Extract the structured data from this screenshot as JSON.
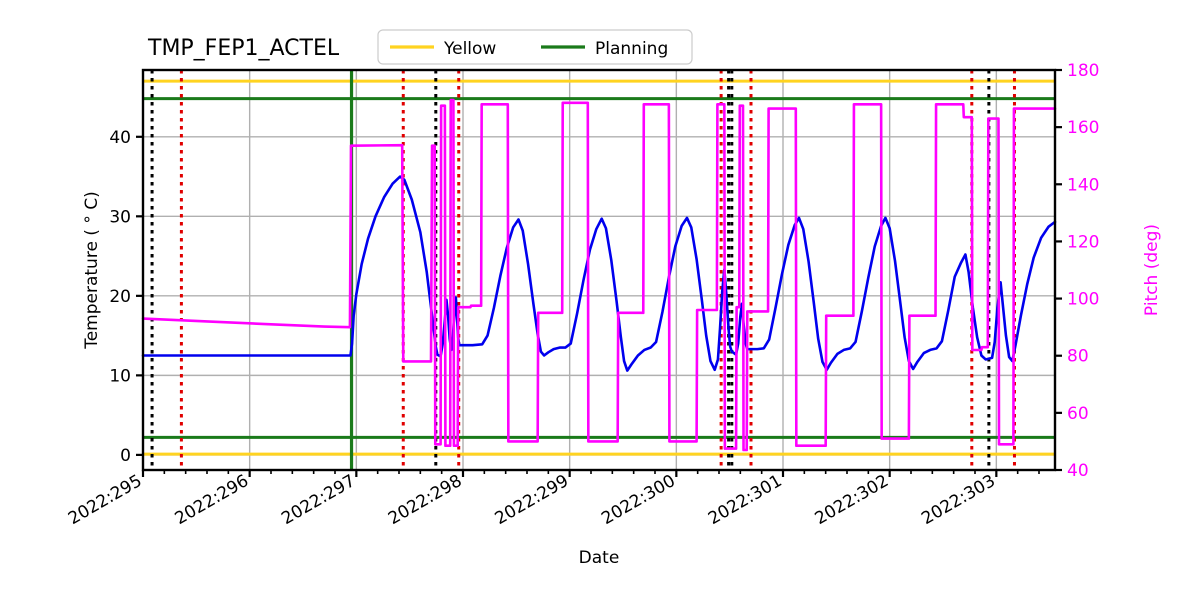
{
  "chart_data": {
    "type": "line",
    "title": "TMP_FEP1_ACTEL",
    "xlabel": "Date",
    "ylabel": "Temperature ( ° C)",
    "y2label": "Pitch (deg)",
    "xlim": [
      295.0,
      303.55
    ],
    "ylim": [
      -1.9,
      48.4
    ],
    "y2lim": [
      40.0,
      180.0
    ],
    "grid": true,
    "legend_position": "upper-center",
    "legend": [
      {
        "label": "Yellow",
        "color": "#FFD320"
      },
      {
        "label": "Planning",
        "color": "#1A7A1A"
      }
    ],
    "xticks": [
      {
        "value": 295,
        "label": "2022:295"
      },
      {
        "value": 296,
        "label": "2022:296"
      },
      {
        "value": 297,
        "label": "2022:297"
      },
      {
        "value": 298,
        "label": "2022:298"
      },
      {
        "value": 299,
        "label": "2022:299"
      },
      {
        "value": 300,
        "label": "2022:300"
      },
      {
        "value": 301,
        "label": "2022:301"
      },
      {
        "value": 302,
        "label": "2022:302"
      },
      {
        "value": 303,
        "label": "2022:303"
      }
    ],
    "yticks": [
      {
        "value": 0,
        "label": "0"
      },
      {
        "value": 10,
        "label": "10"
      },
      {
        "value": 20,
        "label": "20"
      },
      {
        "value": 30,
        "label": "30"
      },
      {
        "value": 40,
        "label": "40"
      }
    ],
    "y2ticks": [
      {
        "value": 40,
        "label": "40"
      },
      {
        "value": 60,
        "label": "60"
      },
      {
        "value": 80,
        "label": "80"
      },
      {
        "value": 100,
        "label": "100"
      },
      {
        "value": 120,
        "label": "120"
      },
      {
        "value": 140,
        "label": "140"
      },
      {
        "value": 160,
        "label": "160"
      },
      {
        "value": 180,
        "label": "180"
      }
    ],
    "hlines": [
      {
        "name": "yellow-high-limit",
        "value": 47.0,
        "color": "#FFD320",
        "axis": "left"
      },
      {
        "name": "planning-high-limit",
        "value": 44.8,
        "color": "#1A7A1A",
        "axis": "left"
      },
      {
        "name": "planning-low-limit",
        "value": 2.2,
        "color": "#1A7A1A",
        "axis": "left"
      },
      {
        "name": "yellow-low-limit",
        "value": 0.1,
        "color": "#FFD320",
        "axis": "left"
      }
    ],
    "vlines_black": [
      295.085,
      297.745,
      300.49,
      300.52,
      302.93
    ],
    "vlines_red": [
      295.36,
      297.44,
      297.96,
      300.42,
      300.7,
      302.77,
      303.17
    ],
    "vline_green": 296.955,
    "series": [
      {
        "name": "temperature",
        "color": "#0000EE",
        "axis": "left",
        "points": [
          [
            295.0,
            12.5
          ],
          [
            295.3,
            12.5
          ],
          [
            295.7,
            12.5
          ],
          [
            296.1,
            12.5
          ],
          [
            296.5,
            12.5
          ],
          [
            296.85,
            12.5
          ],
          [
            296.945,
            12.5
          ],
          [
            296.96,
            14.0
          ],
          [
            296.975,
            17.5
          ],
          [
            297.0,
            20.2
          ],
          [
            297.05,
            24.0
          ],
          [
            297.11,
            27.2
          ],
          [
            297.18,
            30.0
          ],
          [
            297.26,
            32.4
          ],
          [
            297.34,
            34.1
          ],
          [
            297.41,
            35.0
          ],
          [
            297.45,
            34.6
          ],
          [
            297.52,
            32.1
          ],
          [
            297.6,
            28.0
          ],
          [
            297.66,
            23.0
          ],
          [
            297.71,
            17.5
          ],
          [
            297.745,
            13.6
          ],
          [
            297.76,
            12.6
          ],
          [
            297.79,
            12.4
          ],
          [
            297.81,
            14.0
          ],
          [
            297.83,
            17.0
          ],
          [
            297.845,
            19.5
          ],
          [
            297.86,
            17.5
          ],
          [
            297.875,
            14.6
          ],
          [
            297.89,
            13.2
          ],
          [
            297.905,
            14.8
          ],
          [
            297.92,
            18.0
          ],
          [
            297.933,
            19.8
          ],
          [
            297.945,
            17.0
          ],
          [
            297.955,
            14.7
          ],
          [
            297.965,
            13.8
          ],
          [
            298.0,
            13.8
          ],
          [
            298.09,
            13.8
          ],
          [
            298.18,
            13.9
          ],
          [
            298.23,
            15.0
          ],
          [
            298.29,
            18.5
          ],
          [
            298.35,
            22.5
          ],
          [
            298.41,
            26.0
          ],
          [
            298.47,
            28.6
          ],
          [
            298.52,
            29.6
          ],
          [
            298.56,
            28.2
          ],
          [
            298.61,
            24.0
          ],
          [
            298.66,
            19.0
          ],
          [
            298.7,
            15.2
          ],
          [
            298.73,
            13.0
          ],
          [
            298.76,
            12.5
          ],
          [
            298.8,
            12.9
          ],
          [
            298.85,
            13.3
          ],
          [
            298.91,
            13.5
          ],
          [
            298.96,
            13.5
          ],
          [
            299.01,
            14.0
          ],
          [
            299.07,
            17.8
          ],
          [
            299.13,
            22.0
          ],
          [
            299.19,
            25.8
          ],
          [
            299.25,
            28.4
          ],
          [
            299.3,
            29.7
          ],
          [
            299.34,
            28.5
          ],
          [
            299.39,
            24.5
          ],
          [
            299.44,
            19.3
          ],
          [
            299.48,
            14.8
          ],
          [
            299.51,
            11.8
          ],
          [
            299.54,
            10.6
          ],
          [
            299.58,
            11.4
          ],
          [
            299.64,
            12.5
          ],
          [
            299.7,
            13.2
          ],
          [
            299.76,
            13.5
          ],
          [
            299.81,
            14.2
          ],
          [
            299.87,
            18.0
          ],
          [
            299.93,
            22.3
          ],
          [
            299.99,
            26.2
          ],
          [
            300.05,
            28.8
          ],
          [
            300.1,
            29.8
          ],
          [
            300.14,
            28.6
          ],
          [
            300.19,
            24.6
          ],
          [
            300.24,
            19.4
          ],
          [
            300.28,
            15.0
          ],
          [
            300.32,
            11.8
          ],
          [
            300.36,
            10.7
          ],
          [
            300.39,
            12.0
          ],
          [
            300.41,
            16.0
          ],
          [
            300.43,
            20.5
          ],
          [
            300.45,
            23.3
          ],
          [
            300.47,
            20.0
          ],
          [
            300.49,
            15.8
          ],
          [
            300.505,
            13.6
          ],
          [
            300.52,
            13.0
          ],
          [
            300.54,
            12.8
          ],
          [
            300.56,
            12.6
          ],
          [
            300.58,
            14.0
          ],
          [
            300.6,
            17.4
          ],
          [
            300.615,
            19.0
          ],
          [
            300.63,
            16.5
          ],
          [
            300.65,
            14.0
          ],
          [
            300.665,
            13.3
          ],
          [
            300.7,
            13.3
          ],
          [
            300.76,
            13.3
          ],
          [
            300.82,
            13.4
          ],
          [
            300.87,
            14.5
          ],
          [
            300.93,
            18.5
          ],
          [
            300.99,
            22.7
          ],
          [
            301.05,
            26.4
          ],
          [
            301.11,
            28.9
          ],
          [
            301.15,
            29.8
          ],
          [
            301.19,
            28.4
          ],
          [
            301.24,
            24.3
          ],
          [
            301.29,
            19.0
          ],
          [
            301.33,
            14.6
          ],
          [
            301.37,
            11.7
          ],
          [
            301.41,
            10.7
          ],
          [
            301.45,
            11.6
          ],
          [
            301.51,
            12.7
          ],
          [
            301.57,
            13.2
          ],
          [
            301.63,
            13.4
          ],
          [
            301.68,
            14.2
          ],
          [
            301.74,
            18.1
          ],
          [
            301.8,
            22.3
          ],
          [
            301.86,
            26.2
          ],
          [
            301.92,
            28.8
          ],
          [
            301.96,
            29.8
          ],
          [
            302.0,
            28.5
          ],
          [
            302.05,
            24.4
          ],
          [
            302.1,
            19.1
          ],
          [
            302.14,
            14.8
          ],
          [
            302.18,
            11.8
          ],
          [
            302.22,
            10.8
          ],
          [
            302.26,
            11.7
          ],
          [
            302.32,
            12.8
          ],
          [
            302.38,
            13.2
          ],
          [
            302.44,
            13.4
          ],
          [
            302.49,
            14.3
          ],
          [
            302.55,
            18.2
          ],
          [
            302.61,
            22.4
          ],
          [
            302.67,
            24.2
          ],
          [
            302.71,
            25.2
          ],
          [
            302.74,
            23.0
          ],
          [
            302.78,
            18.5
          ],
          [
            302.82,
            14.8
          ],
          [
            302.86,
            12.5
          ],
          [
            302.9,
            12.0
          ],
          [
            302.93,
            12.1
          ],
          [
            302.96,
            12.2
          ],
          [
            302.985,
            14.2
          ],
          [
            303.01,
            18.5
          ],
          [
            303.04,
            21.7
          ],
          [
            303.06,
            19.0
          ],
          [
            303.09,
            15.0
          ],
          [
            303.12,
            12.3
          ],
          [
            303.15,
            11.8
          ],
          [
            303.18,
            13.8
          ],
          [
            303.23,
            17.5
          ],
          [
            303.29,
            21.5
          ],
          [
            303.35,
            24.8
          ],
          [
            303.42,
            27.3
          ],
          [
            303.49,
            28.7
          ],
          [
            303.55,
            29.3
          ]
        ]
      },
      {
        "name": "pitch",
        "color": "#FF00FF",
        "axis": "right",
        "points": [
          [
            295.0,
            93.0
          ],
          [
            295.6,
            92.0
          ],
          [
            296.2,
            91.0
          ],
          [
            296.7,
            90.2
          ],
          [
            296.94,
            90.0
          ],
          [
            296.95,
            153.5
          ],
          [
            297.43,
            153.7
          ],
          [
            297.44,
            78.0
          ],
          [
            297.7,
            78.0
          ],
          [
            297.71,
            153.5
          ],
          [
            297.735,
            153.5
          ],
          [
            297.74,
            49.0
          ],
          [
            297.79,
            49.0
          ],
          [
            297.795,
            167.5
          ],
          [
            297.83,
            167.5
          ],
          [
            297.835,
            48.5
          ],
          [
            297.88,
            48.5
          ],
          [
            297.885,
            169.5
          ],
          [
            297.91,
            169.5
          ],
          [
            297.915,
            48.5
          ],
          [
            297.95,
            48.5
          ],
          [
            297.955,
            97.0
          ],
          [
            298.07,
            97.0
          ],
          [
            298.075,
            97.5
          ],
          [
            298.17,
            97.5
          ],
          [
            298.175,
            168.0
          ],
          [
            298.42,
            168.0
          ],
          [
            298.425,
            50.0
          ],
          [
            298.7,
            50.0
          ],
          [
            298.705,
            95.0
          ],
          [
            298.93,
            95.0
          ],
          [
            298.935,
            168.5
          ],
          [
            299.17,
            168.5
          ],
          [
            299.175,
            50.0
          ],
          [
            299.45,
            50.0
          ],
          [
            299.455,
            95.0
          ],
          [
            299.69,
            95.0
          ],
          [
            299.695,
            168.0
          ],
          [
            299.93,
            168.0
          ],
          [
            299.935,
            50.0
          ],
          [
            300.19,
            50.0
          ],
          [
            300.195,
            96.0
          ],
          [
            300.38,
            96.0
          ],
          [
            300.385,
            168.0
          ],
          [
            300.45,
            168.0
          ],
          [
            300.455,
            47.5
          ],
          [
            300.56,
            47.5
          ],
          [
            300.565,
            97.0
          ],
          [
            300.59,
            97.0
          ],
          [
            300.595,
            167.5
          ],
          [
            300.625,
            167.5
          ],
          [
            300.63,
            47.0
          ],
          [
            300.66,
            47.0
          ],
          [
            300.665,
            95.5
          ],
          [
            300.86,
            95.5
          ],
          [
            300.865,
            166.5
          ],
          [
            301.12,
            166.5
          ],
          [
            301.125,
            48.5
          ],
          [
            301.4,
            48.5
          ],
          [
            301.405,
            94.0
          ],
          [
            301.66,
            94.0
          ],
          [
            301.665,
            168.0
          ],
          [
            301.92,
            168.0
          ],
          [
            301.925,
            51.0
          ],
          [
            302.18,
            51.0
          ],
          [
            302.185,
            94.0
          ],
          [
            302.43,
            94.0
          ],
          [
            302.435,
            168.0
          ],
          [
            302.69,
            168.0
          ],
          [
            302.695,
            163.5
          ],
          [
            302.77,
            163.5
          ],
          [
            302.775,
            82.0
          ],
          [
            302.86,
            82.0
          ],
          [
            302.865,
            83.0
          ],
          [
            302.92,
            83.0
          ],
          [
            302.925,
            163.0
          ],
          [
            303.02,
            163.0
          ],
          [
            303.025,
            49.0
          ],
          [
            303.16,
            49.0
          ],
          [
            303.165,
            166.5
          ],
          [
            303.55,
            166.5
          ]
        ]
      }
    ]
  }
}
